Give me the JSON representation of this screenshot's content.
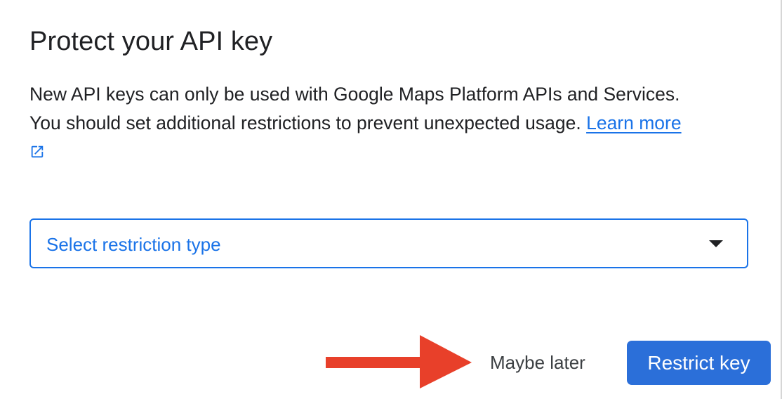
{
  "dialog": {
    "title": "Protect your API key",
    "body_line_1": "New API keys can only be used with Google Maps Platform APIs and Services.",
    "body_line_2": "You should set additional restrictions to prevent unexpected usage.",
    "learn_more_label": "Learn more",
    "external_link_icon": "open-in-new-icon"
  },
  "restriction_select": {
    "value": "Select restriction type",
    "caret_icon": "dropdown-caret-icon"
  },
  "actions": {
    "maybe_later_label": "Maybe later",
    "restrict_key_label": "Restrict key"
  },
  "annotation": {
    "icon": "red-arrow-icon",
    "color": "#e8402a"
  },
  "colors": {
    "accent": "#1a73e8",
    "primary_button": "#2b6fd9",
    "text": "#202124"
  }
}
